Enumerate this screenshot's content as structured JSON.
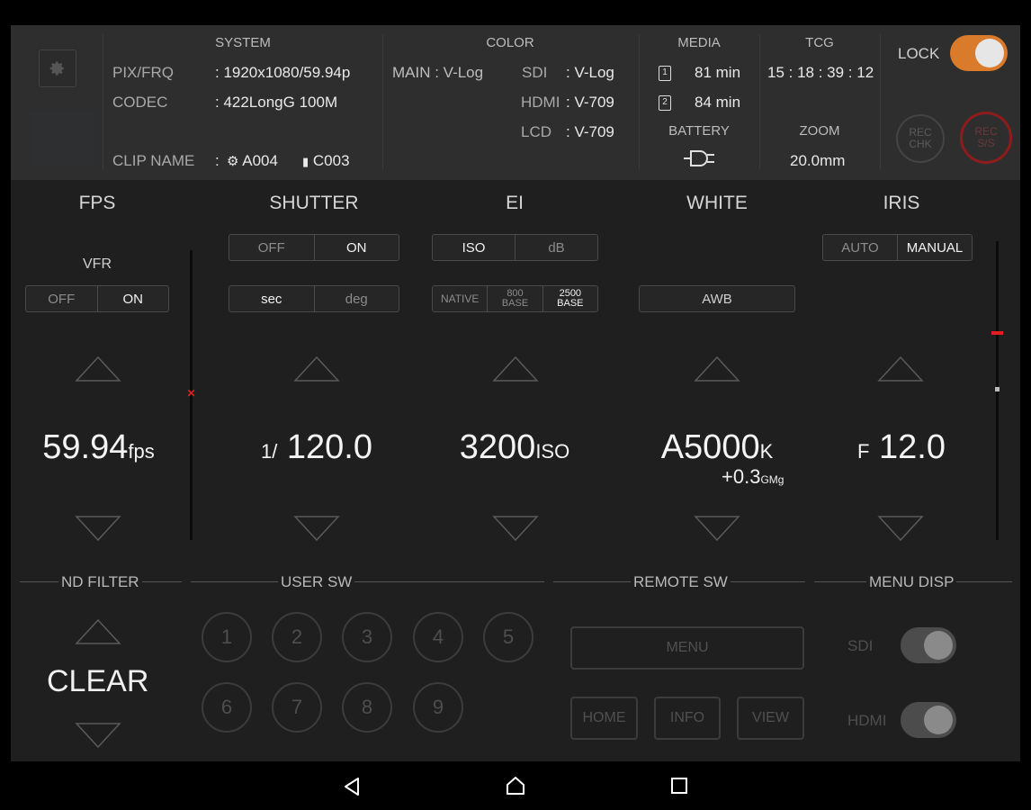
{
  "system": {
    "title": "SYSTEM",
    "pix_label": "PIX/FRQ",
    "pix_value": ": 1920x1080/59.94p",
    "codec_label": "CODEC",
    "codec_value": ": 422LongG 100M",
    "clip_label": "CLIP NAME",
    "clip_colon": ":",
    "clip_a": "A004",
    "clip_c": "C003"
  },
  "color": {
    "title": "COLOR",
    "main": "MAIN : V-Log",
    "sdi_label": "SDI",
    "sdi_value": ": V-Log",
    "hdmi_label": "HDMI",
    "hdmi_value": ": V-709",
    "lcd_label": "LCD",
    "lcd_value": ": V-709"
  },
  "media": {
    "title": "MEDIA",
    "slot1_icon": "1",
    "slot1": "81 min",
    "slot2_icon": "2",
    "slot2": "84 min",
    "battery_label": "BATTERY",
    "battery_icon": "power-plug-icon"
  },
  "tcg": {
    "title": "TCG",
    "value": "15 : 18 : 39 : 12",
    "zoom_label": "ZOOM",
    "zoom_value": "20.0mm"
  },
  "lock": {
    "label": "LOCK",
    "on": true,
    "accent": "#d97b2b"
  },
  "rec_chk": {
    "line1": "REC",
    "line2": "CHK"
  },
  "rec_ss": {
    "line1": "REC",
    "line2": "S/S",
    "color": "#8e1c1c"
  },
  "fps": {
    "title": "FPS",
    "vfr_label": "VFR",
    "vfr_off": "OFF",
    "vfr_on": "ON",
    "value": "59.94",
    "unit": "fps"
  },
  "shutter": {
    "title": "SHUTTER",
    "off": "OFF",
    "on": "ON",
    "sec": "sec",
    "deg": "deg",
    "prefix": "1/",
    "value": "120.0"
  },
  "ei": {
    "title": "EI",
    "iso": "ISO",
    "db": "dB",
    "native": "NATIVE",
    "base800_a": "800",
    "base800_b": "BASE",
    "base2500_a": "2500",
    "base2500_b": "BASE",
    "value": "3200",
    "unit": "ISO"
  },
  "white": {
    "title": "WHITE",
    "awb": "AWB",
    "value": "A5000",
    "unit": "K",
    "gmg": "+0.3",
    "gmg_unit": "GMg"
  },
  "iris": {
    "title": "IRIS",
    "auto": "AUTO",
    "manual": "MANUAL",
    "prefix": "F",
    "value": "12.0"
  },
  "bottom": {
    "nd_title": "ND FILTER",
    "nd_value": "CLEAR",
    "user_title": "USER SW",
    "user_buttons": [
      "1",
      "2",
      "3",
      "4",
      "5",
      "6",
      "7",
      "8",
      "9"
    ],
    "remote_title": "REMOTE SW",
    "menu": "MENU",
    "home": "HOME",
    "info": "INFO",
    "view": "VIEW",
    "menu_disp_title": "MENU DISP",
    "sdi_label": "SDI",
    "hdmi_label": "HDMI"
  }
}
